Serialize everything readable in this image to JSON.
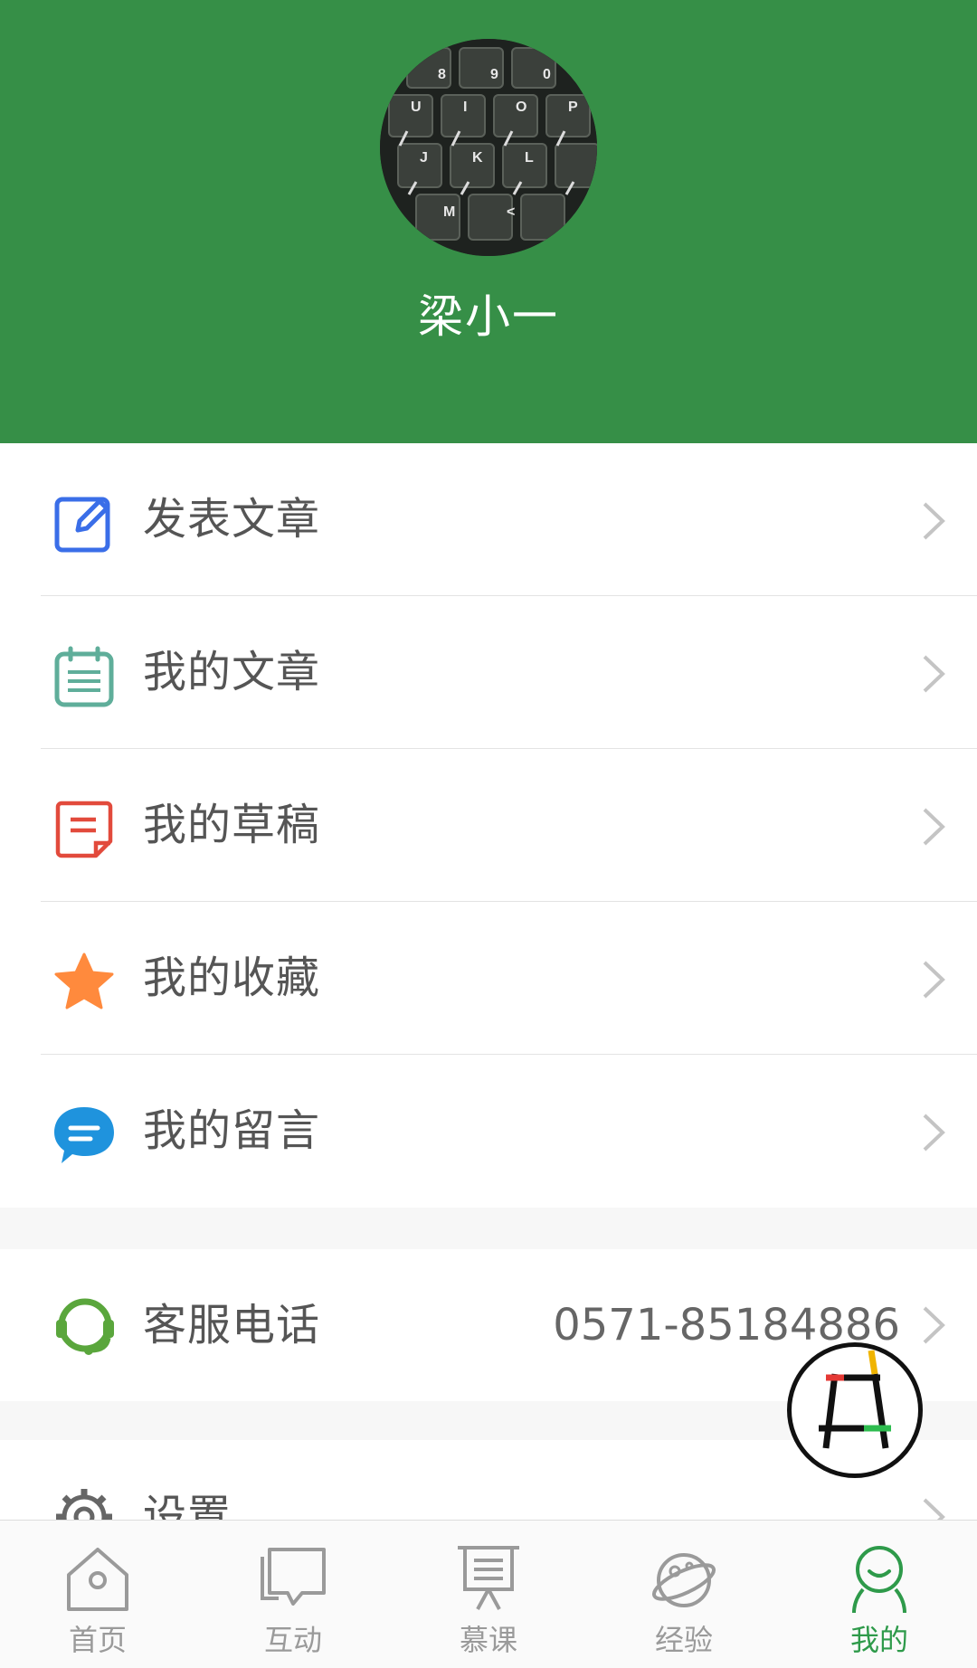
{
  "profile": {
    "name": "梁小一",
    "header_color": "#368f47",
    "avatar_keys": [
      "8",
      "9",
      "0",
      "U",
      "I",
      "O",
      "P",
      "J",
      "K",
      "L",
      "M",
      "<"
    ]
  },
  "menu": [
    {
      "label": "发表文章",
      "icon": "edit-icon",
      "color": "#3a6ee8"
    },
    {
      "label": "我的文章",
      "icon": "notepad-icon",
      "color": "#5fae9a"
    },
    {
      "label": "我的草稿",
      "icon": "draft-icon",
      "color": "#e24a3c"
    },
    {
      "label": "我的收藏",
      "icon": "star-icon",
      "color": "#ff8a3d"
    },
    {
      "label": "我的留言",
      "icon": "message-icon",
      "color": "#1f93dd"
    }
  ],
  "service": {
    "label": "客服电话",
    "phone": "0571-85184886",
    "icon": "headset-icon"
  },
  "settings": {
    "label": "设置",
    "icon": "gear-icon"
  },
  "tabs": [
    {
      "label": "首页",
      "icon": "home-icon"
    },
    {
      "label": "互动",
      "icon": "chat-icon"
    },
    {
      "label": "慕课",
      "icon": "presentation-icon"
    },
    {
      "label": "经验",
      "icon": "planet-icon"
    },
    {
      "label": "我的",
      "icon": "person-icon",
      "active": true
    }
  ]
}
